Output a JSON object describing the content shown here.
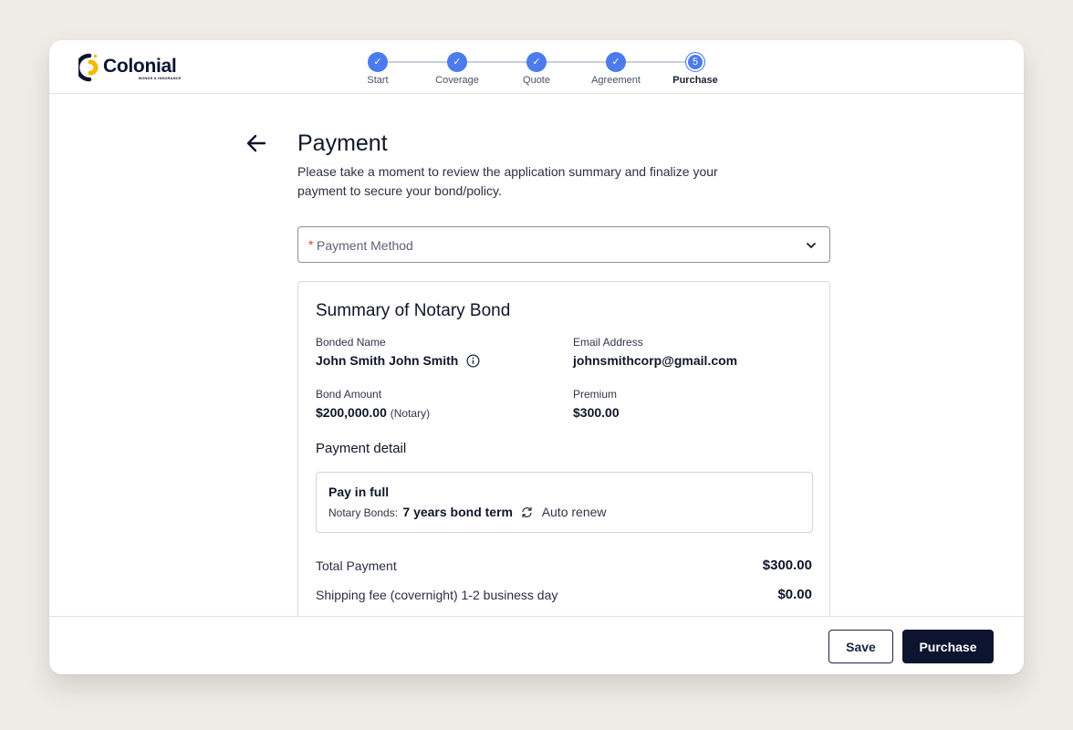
{
  "header": {
    "brand": "Colonial",
    "brand_sub": "BONDS & INSURANCE",
    "steps": [
      {
        "label": "Start",
        "status": "done"
      },
      {
        "label": "Coverage",
        "status": "done"
      },
      {
        "label": "Quote",
        "status": "done"
      },
      {
        "label": "Agreement",
        "status": "done"
      },
      {
        "label": "Purchase",
        "status": "current",
        "number": "5"
      }
    ]
  },
  "page": {
    "title": "Payment",
    "subtitle": "Please take a moment to review the application summary and finalize your payment to secure your bond/policy.",
    "payment_method": {
      "required_mark": "*",
      "placeholder": "Payment Method"
    }
  },
  "summary": {
    "title": "Summary of Notary Bond",
    "bonded_name_label": "Bonded Name",
    "bonded_name": "John Smith John Smith",
    "email_label": "Email Address",
    "email": "johnsmithcorp@gmail.com",
    "bond_amount_label": "Bond Amount",
    "bond_amount": "$200,000.00",
    "bond_amount_note": "(Notary)",
    "premium_label": "Premium",
    "premium": "$300.00",
    "payment_detail": {
      "title": "Payment detail",
      "plan": "Pay in full",
      "line_label": "Notary Bonds:",
      "term": "7 years bond term",
      "renew": "Auto renew"
    },
    "total_label": "Total Payment",
    "total": "$300.00",
    "shipping_label": "Shipping fee (covernight) 1-2 business day",
    "shipping": "$0.00"
  },
  "footer": {
    "save_label": "Save",
    "purchase_label": "Purchase"
  },
  "colors": {
    "accent": "#4b7bec",
    "primary_dark": "#0c1430",
    "required": "#e03c31",
    "logo_yellow": "#f5b800"
  },
  "icons": [
    "back-arrow-icon",
    "chevron-down-icon",
    "info-icon",
    "refresh-icon",
    "check-icon"
  ]
}
